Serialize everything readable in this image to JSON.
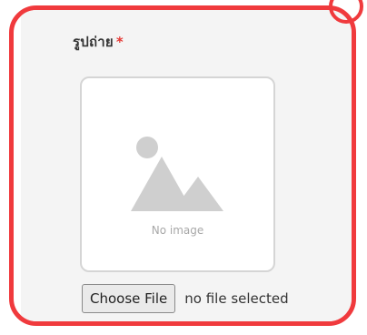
{
  "field": {
    "label": "รูปถ่าย",
    "required_mark": "*"
  },
  "image_preview": {
    "placeholder_text": "No image",
    "icon": "image-placeholder-icon"
  },
  "file_input": {
    "button_label": "Choose File",
    "status_text": "no file selected"
  },
  "colors": {
    "highlight_border": "#f03a3d",
    "required": "#e53935",
    "panel_background": "#f4f4f4"
  }
}
